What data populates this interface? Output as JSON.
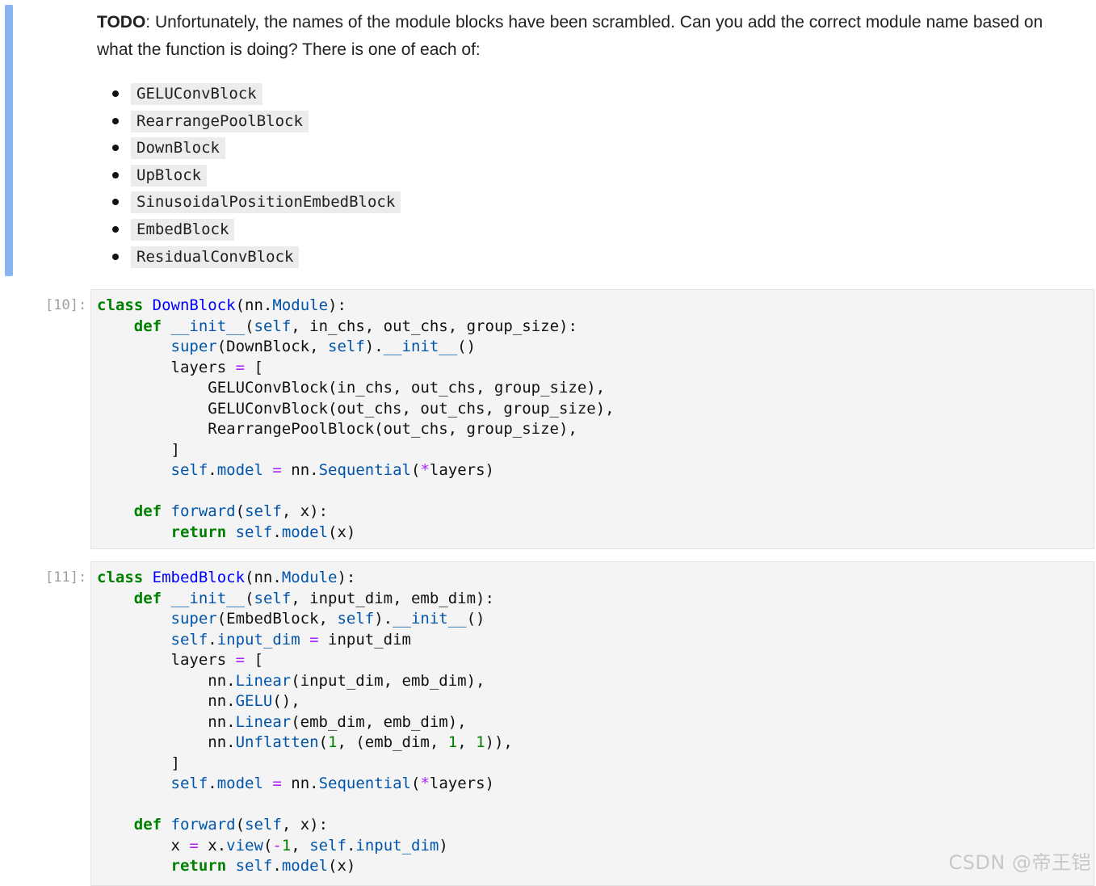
{
  "markdown": {
    "todo_label": "TODO",
    "todo_text": ": Unfortunately, the names of the module blocks have been scrambled. Can you add the correct module name based on what the function is doing? There is one of each of:",
    "items": [
      "GELUConvBlock",
      "RearrangePoolBlock",
      "DownBlock",
      "UpBlock",
      "SinusoidalPositionEmbedBlock",
      "EmbedBlock",
      "ResidualConvBlock"
    ]
  },
  "cells": [
    {
      "prompt": "[10]:",
      "lines": [
        "class DownBlock(nn.Module):",
        "    def __init__(self, in_chs, out_chs, group_size):",
        "        super(DownBlock, self).__init__()",
        "        layers = [",
        "            GELUConvBlock(in_chs, out_chs, group_size),",
        "            GELUConvBlock(out_chs, out_chs, group_size),",
        "            RearrangePoolBlock(out_chs, group_size),",
        "        ]",
        "        self.model = nn.Sequential(*layers)",
        "",
        "    def forward(self, x):",
        "        return self.model(x)"
      ]
    },
    {
      "prompt": "[11]:",
      "lines": [
        "class EmbedBlock(nn.Module):",
        "    def __init__(self, input_dim, emb_dim):",
        "        super(EmbedBlock, self).__init__()",
        "        self.input_dim = input_dim",
        "        layers = [",
        "            nn.Linear(input_dim, emb_dim),",
        "            nn.GELU(),",
        "            nn.Linear(emb_dim, emb_dim),",
        "            nn.Unflatten(1, (emb_dim, 1, 1)),",
        "        ]",
        "        self.model = nn.Sequential(*layers)",
        "",
        "    def forward(self, x):",
        "        x = x.view(-1, self.input_dim)",
        "        return self.model(x)"
      ]
    }
  ],
  "watermark": "CSDN @帝王铠"
}
